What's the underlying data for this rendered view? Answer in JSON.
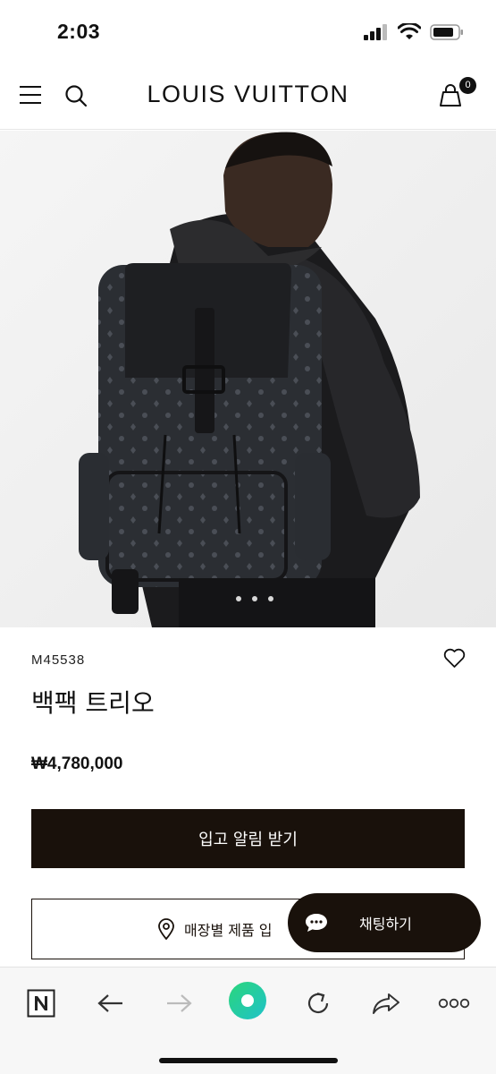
{
  "status": {
    "time": "2:03"
  },
  "header": {
    "brand": "LOUIS VUITTON",
    "cart_count": "0"
  },
  "product": {
    "sku": "M45538",
    "name": "백팩 트리오",
    "price": "₩4,780,000",
    "image_icon": "backpack-model-photo",
    "carousel_dots": 3
  },
  "actions": {
    "notify_label": "입고 알림 받기",
    "store_label": "매장별 제품 입",
    "chat_label": "채팅하기"
  },
  "browser": {
    "icons": [
      "naver-n-icon",
      "back-arrow-icon",
      "forward-arrow-icon",
      "naver-home-icon",
      "reload-icon",
      "share-icon",
      "more-icon"
    ]
  },
  "colors": {
    "brand_dark": "#19110b",
    "home_green": "#2bd67b"
  }
}
